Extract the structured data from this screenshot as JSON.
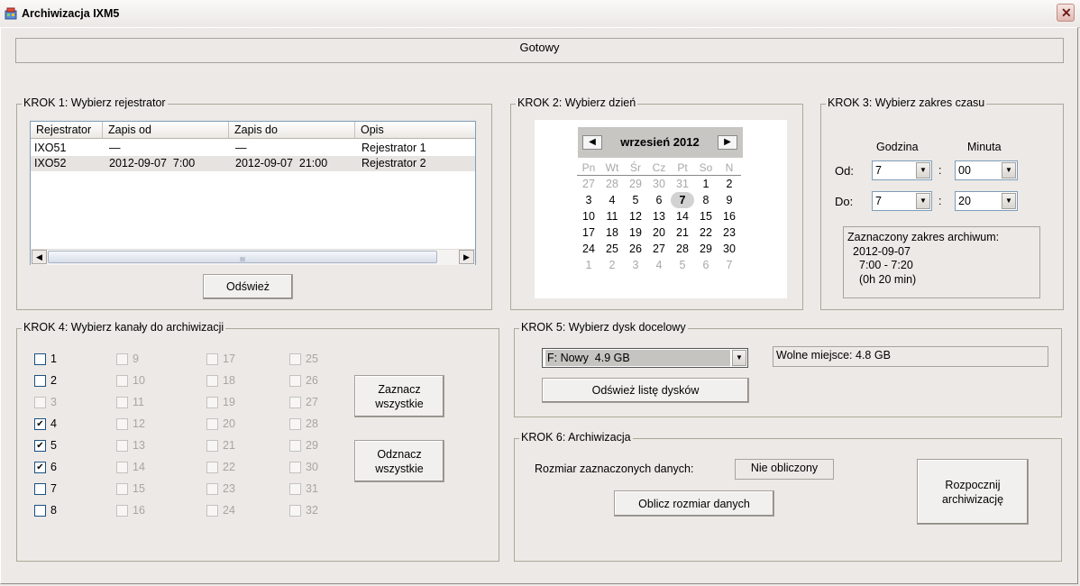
{
  "window": {
    "title": "Archiwizacja IXM5",
    "close_symbol": "✕"
  },
  "status": "Gotowy",
  "step1": {
    "legend": "KROK 1: Wybierz rejestrator",
    "columns": [
      "Rejestrator",
      "Zapis od",
      "Zapis do",
      "Opis"
    ],
    "rows": [
      [
        "IXO51",
        "—",
        "—",
        "Rejestrator 1"
      ],
      [
        "IXO52",
        "2012-09-07  7:00",
        "2012-09-07  21:00",
        "Rejestrator 2"
      ]
    ],
    "scroll_left": "◀",
    "scroll_right": "▶",
    "scroll_grip": "III",
    "refresh_button": "Odśwież"
  },
  "step2": {
    "legend": "KROK 2: Wybierz dzień",
    "month_label": "wrzesień 2012",
    "prev": "◀",
    "next": "▶",
    "weekdays": [
      "Pn",
      "Wt",
      "Śr",
      "Cz",
      "Pt",
      "So",
      "N"
    ],
    "weeks": [
      [
        "27",
        "28",
        "29",
        "30",
        "31",
        "1",
        "2"
      ],
      [
        "3",
        "4",
        "5",
        "6",
        "7",
        "8",
        "9"
      ],
      [
        "10",
        "11",
        "12",
        "13",
        "14",
        "15",
        "16"
      ],
      [
        "17",
        "18",
        "19",
        "20",
        "21",
        "22",
        "23"
      ],
      [
        "24",
        "25",
        "26",
        "27",
        "28",
        "29",
        "30"
      ],
      [
        "1",
        "2",
        "3",
        "4",
        "5",
        "6",
        "7"
      ]
    ],
    "selected_day": "7"
  },
  "step3": {
    "legend": "KROK 3: Wybierz zakres czasu",
    "hour_header": "Godzina",
    "minute_header": "Minuta",
    "from_label": "Od:",
    "to_label": "Do:",
    "from_hour": "7",
    "from_minute": "00",
    "to_hour": "7",
    "to_minute": "20",
    "separator": ":",
    "summary_title": "Zaznaczony zakres archiwum:",
    "summary_date": "2012-09-07",
    "summary_range": "7:00 - 7:20",
    "summary_duration": "(0h 20 min)"
  },
  "step4": {
    "legend": "KROK 4: Wybierz kanały do archiwizacji",
    "channels": [
      {
        "label": "1",
        "checked": false,
        "enabled": true
      },
      {
        "label": "2",
        "checked": false,
        "enabled": true
      },
      {
        "label": "3",
        "checked": false,
        "enabled": false
      },
      {
        "label": "4",
        "checked": true,
        "enabled": true
      },
      {
        "label": "5",
        "checked": true,
        "enabled": true
      },
      {
        "label": "6",
        "checked": true,
        "enabled": true
      },
      {
        "label": "7",
        "checked": false,
        "enabled": true
      },
      {
        "label": "8",
        "checked": false,
        "enabled": true
      },
      {
        "label": "9",
        "checked": false,
        "enabled": false
      },
      {
        "label": "10",
        "checked": false,
        "enabled": false
      },
      {
        "label": "11",
        "checked": false,
        "enabled": false
      },
      {
        "label": "12",
        "checked": false,
        "enabled": false
      },
      {
        "label": "13",
        "checked": false,
        "enabled": false
      },
      {
        "label": "14",
        "checked": false,
        "enabled": false
      },
      {
        "label": "15",
        "checked": false,
        "enabled": false
      },
      {
        "label": "16",
        "checked": false,
        "enabled": false
      },
      {
        "label": "17",
        "checked": false,
        "enabled": false
      },
      {
        "label": "18",
        "checked": false,
        "enabled": false
      },
      {
        "label": "19",
        "checked": false,
        "enabled": false
      },
      {
        "label": "20",
        "checked": false,
        "enabled": false
      },
      {
        "label": "21",
        "checked": false,
        "enabled": false
      },
      {
        "label": "22",
        "checked": false,
        "enabled": false
      },
      {
        "label": "23",
        "checked": false,
        "enabled": false
      },
      {
        "label": "24",
        "checked": false,
        "enabled": false
      },
      {
        "label": "25",
        "checked": false,
        "enabled": false
      },
      {
        "label": "26",
        "checked": false,
        "enabled": false
      },
      {
        "label": "27",
        "checked": false,
        "enabled": false
      },
      {
        "label": "28",
        "checked": false,
        "enabled": false
      },
      {
        "label": "29",
        "checked": false,
        "enabled": false
      },
      {
        "label": "30",
        "checked": false,
        "enabled": false
      },
      {
        "label": "31",
        "checked": false,
        "enabled": false
      },
      {
        "label": "32",
        "checked": false,
        "enabled": false
      }
    ],
    "select_all_line1": "Zaznacz",
    "select_all_line2": "wszystkie",
    "deselect_all_line1": "Odznacz",
    "deselect_all_line2": "wszystkie",
    "check_mark": "✔"
  },
  "step5": {
    "legend": "KROK 5: Wybierz dysk docelowy",
    "disk_value": "F: Nowy  4.9 GB",
    "free_space": "Wolne miejsce: 4.8 GB",
    "refresh_disks_button": "Odśwież listę dysków"
  },
  "step6": {
    "legend": "KROK 6: Archiwizacja",
    "size_label": "Rozmiar zaznaczonych danych:",
    "size_value": "Nie obliczony",
    "calc_button": "Oblicz rozmiar danych",
    "start_line1": "Rozpocznij",
    "start_line2": "archiwizację"
  },
  "dropdown_arrow": "▼"
}
